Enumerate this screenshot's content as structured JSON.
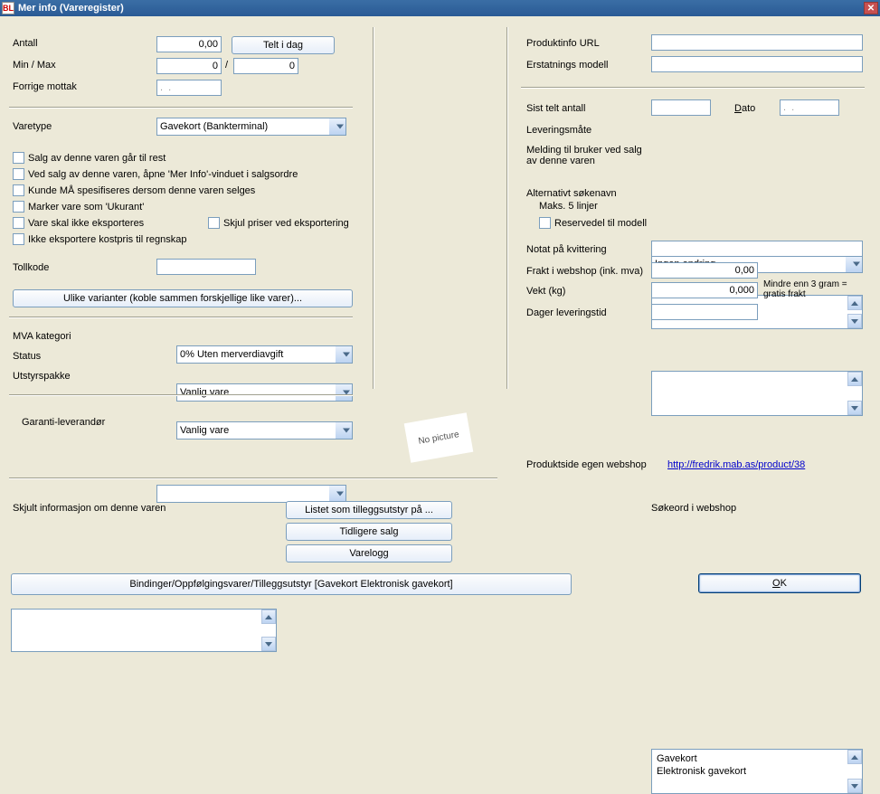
{
  "window": {
    "title": "Mer info (Vareregister)",
    "icon_text": "BL"
  },
  "left": {
    "antall_label": "Antall",
    "antall_value": "0,00",
    "telt_btn": "Telt i dag",
    "minmax_label": "Min / Max",
    "min_value": "0",
    "max_value": "0",
    "slash": "/",
    "forrige_mottak_label": "Forrige mottak",
    "forrige_mottak_value": ".  .",
    "varetype_label": "Varetype",
    "varetype_value": "Gavekort (Bankterminal)",
    "chk1": "Salg av denne varen går til rest",
    "chk2": "Ved salg av denne varen, åpne 'Mer Info'-vinduet i salgsordre",
    "chk3": "Kunde MÅ spesifiseres dersom denne varen selges",
    "chk4": "Marker vare som 'Ukurant'",
    "chk5": "Vare skal ikke eksporteres",
    "chk5b": "Skjul priser ved eksportering",
    "chk6": "Ikke eksportere kostpris til regnskap",
    "tollkode_label": "Tollkode",
    "tollkode_value": "",
    "varianter_btn": "Ulike varianter (koble sammen forskjellige like varer)...",
    "mva_label": "MVA kategori",
    "mva_value": "0% Uten merverdiavgift",
    "status_label": "Status",
    "status_value": "Vanlig vare",
    "utstyr_label": "Utstyrspakke",
    "utstyr_value": "Vanlig vare",
    "garanti_label": "Garanti-leverandør",
    "garanti_value": "",
    "no_picture": "No picture",
    "skjult_label": "Skjult informasjon om denne varen",
    "skjult_value": "",
    "listet_btn": "Listet som tilleggsutstyr på ...",
    "tidligere_btn": "Tidligere salg",
    "varelogg_btn": "Varelogg",
    "bindinger_btn": "Bindinger/Oppfølgingsvarer/Tilleggsutstyr [Gavekort  Elektronisk gavekort]"
  },
  "right": {
    "produktinfo_label": "Produktinfo URL",
    "produktinfo_value": "",
    "erstatning_label": "Erstatnings modell",
    "erstatning_value": "",
    "sist_telt_label": "Sist telt antall",
    "sist_telt_value": "",
    "dato_label": "Dato",
    "dato_label_prefix": "D",
    "dato_value": ".  .",
    "levering_label": "Leveringsmåte",
    "levering_value": "Ingen endring",
    "melding_label": "Melding til bruker ved salg av denne varen",
    "melding_value": "",
    "altnavn_label": "Alternativt søkenavn",
    "altnavn_sub": "Maks. 5 linjer",
    "altnavn_value": "",
    "reservedel_chk": "Reservedel til modell",
    "notat_label": "Notat på kvittering",
    "notat_value": "",
    "frakt_label": "Frakt i webshop (ink. mva)",
    "frakt_value": "0,00",
    "vekt_label": "Vekt (kg)",
    "vekt_value": "0,000",
    "vekt_hint": "Mindre enn 3 gram = gratis frakt",
    "dager_label": "Dager leveringstid",
    "dager_value": "",
    "produktside_label": "Produktside egen webshop",
    "produktside_url": "http://fredrik.mab.as/product/38",
    "sokeord_label": "Søkeord i webshop",
    "sokeord_line1": "Gavekort",
    "sokeord_line2": "Elektronisk gavekort",
    "ok_btn": "OK",
    "ok_u": "O",
    "ok_rest": "K"
  }
}
